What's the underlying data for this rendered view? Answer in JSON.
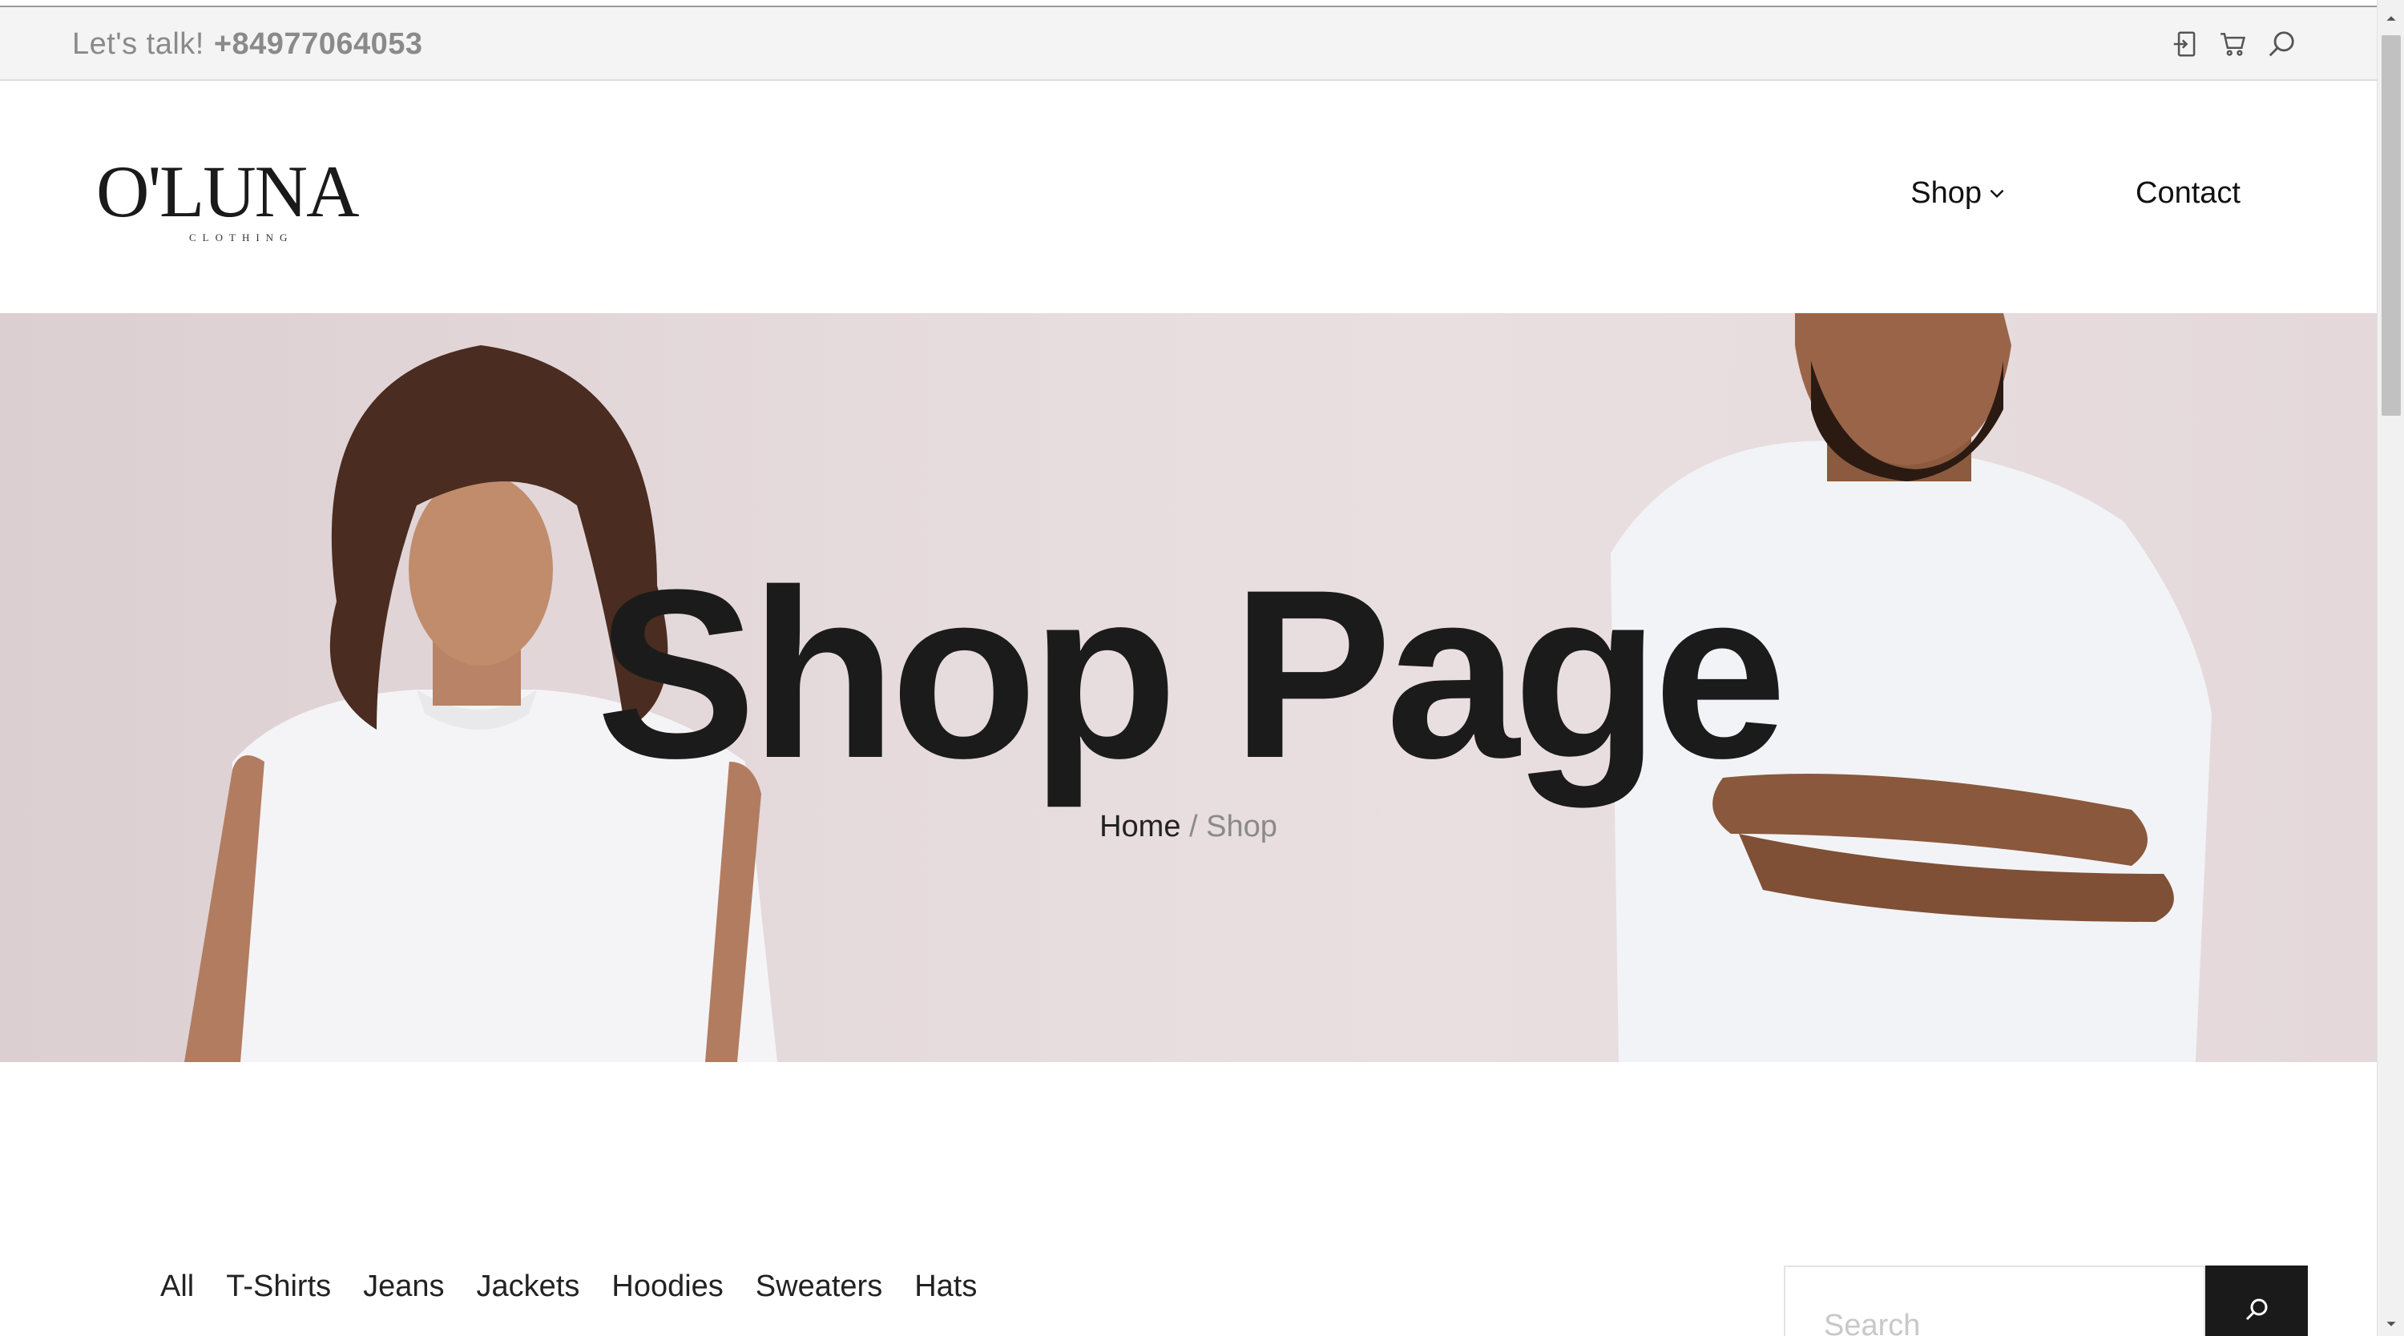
{
  "topbar": {
    "talk_label": "Let's talk!",
    "phone": "+84977064053",
    "icons": [
      "login-icon",
      "cart-icon",
      "search-icon"
    ]
  },
  "header": {
    "logo_text": "O'LUNA",
    "logo_sub": "CLOTHING",
    "nav": {
      "shop": "Shop",
      "contact": "Contact"
    }
  },
  "hero": {
    "title": "Shop Page",
    "breadcrumb": {
      "home": "Home",
      "separator": "/",
      "current": "Shop"
    }
  },
  "filters": {
    "items": [
      "All",
      "T-Shirts",
      "Jeans",
      "Jackets",
      "Hoodies",
      "Sweaters",
      "Hats"
    ]
  },
  "search": {
    "placeholder": "Search",
    "value": ""
  },
  "colors": {
    "accent": "#1a1a1a",
    "topbar_bg": "#f4f4f4",
    "hero_bg": "#e4d8da"
  }
}
